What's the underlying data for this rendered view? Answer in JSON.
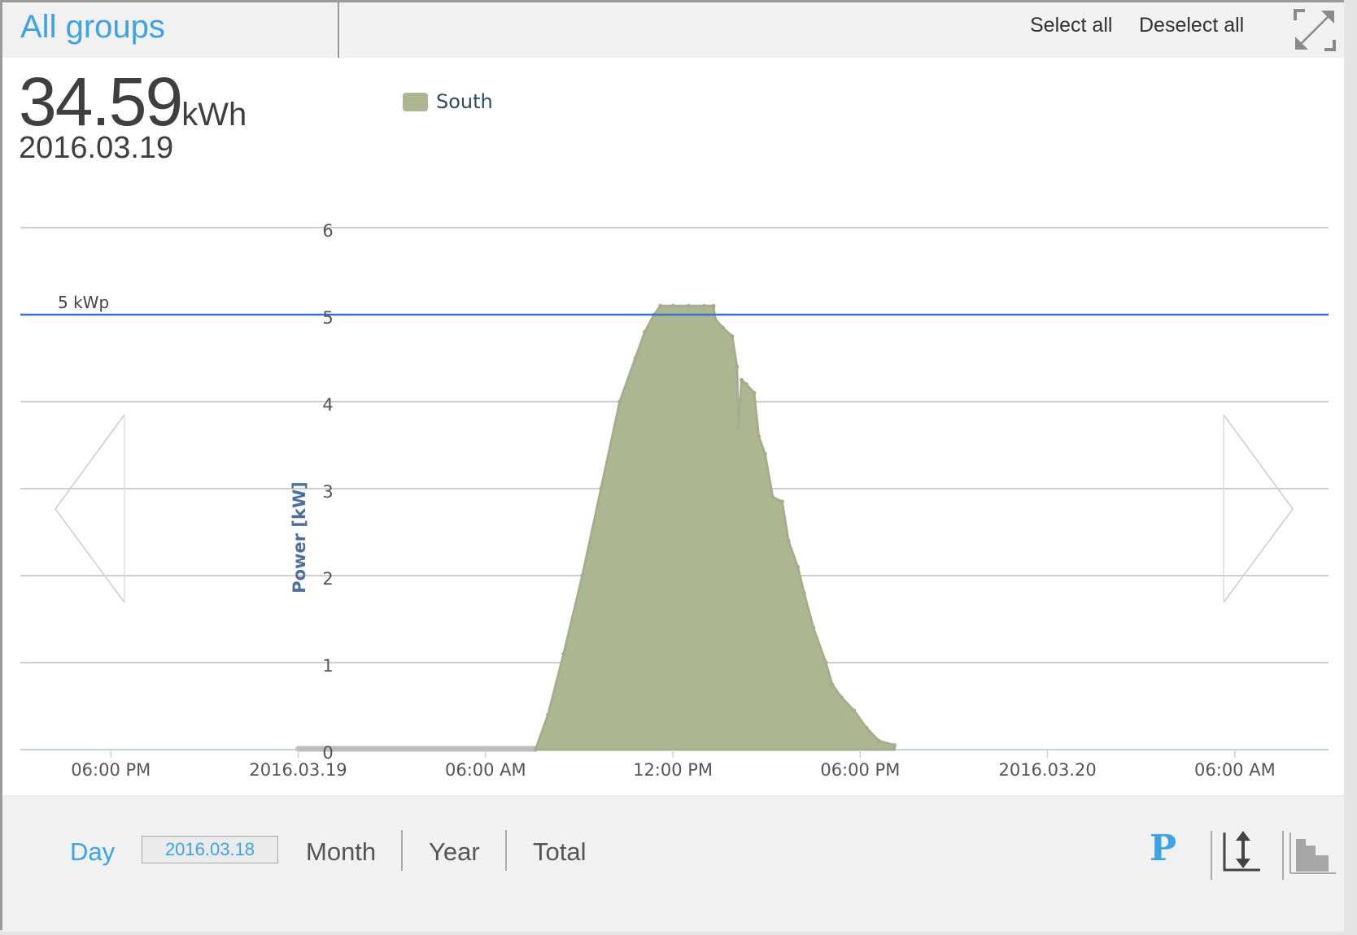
{
  "header": {
    "group_title": "All groups",
    "select_all": "Select all",
    "deselect_all": "Deselect all",
    "expand_icon": "expand-arrows-icon"
  },
  "summary": {
    "value": "34.59",
    "unit": "kWh",
    "date": "2016.03.19"
  },
  "legend": [
    {
      "label": "South",
      "color": "#acb792"
    }
  ],
  "navigation": {
    "prev_icon": "chevron-left-icon",
    "next_icon": "chevron-right-icon"
  },
  "footer": {
    "periods": {
      "day": "Day",
      "month": "Month",
      "year": "Year",
      "total": "Total"
    },
    "active_period": "Day",
    "date_picker_value": "2016.03.18",
    "icons": {
      "power": "P",
      "scale": "y-axis-scale-icon",
      "bars": "bar-chart-icon"
    }
  },
  "colors": {
    "accent": "#3ea3e6",
    "series": "#acb792",
    "reference_line": "#3b73c8",
    "axis_title": "#4d6f99"
  },
  "chart_data": {
    "type": "area",
    "title": "",
    "xlabel": "",
    "ylabel": "Power [kW]",
    "ylim": [
      0,
      6
    ],
    "yticks": [
      0,
      1,
      2,
      3,
      4,
      5,
      6
    ],
    "xlim_hours": [
      -8.9,
      33.0
    ],
    "xticks": [
      {
        "hour": -6,
        "label": "06:00 PM"
      },
      {
        "hour": 0,
        "label": "2016.03.19"
      },
      {
        "hour": 6,
        "label": "06:00 AM"
      },
      {
        "hour": 12,
        "label": "12:00 PM"
      },
      {
        "hour": 18,
        "label": "06:00 PM"
      },
      {
        "hour": 24,
        "label": "2016.03.20"
      },
      {
        "hour": 30,
        "label": "06:00 AM"
      }
    ],
    "grid": true,
    "legend_position": "top-left",
    "reference_line": {
      "value": 5,
      "label": "5 kWp"
    },
    "navigator_range_hours": [
      0,
      7.6
    ],
    "series": [
      {
        "name": "South",
        "x_hours": [
          7.6,
          8.0,
          8.5,
          9.1,
          9.7,
          10.3,
          10.8,
          11.1,
          11.4,
          11.6,
          12.0,
          12.5,
          13.0,
          13.3,
          13.35,
          13.6,
          13.9,
          14.05,
          14.1,
          14.2,
          14.35,
          14.6,
          14.75,
          14.95,
          15.2,
          15.5,
          15.7,
          16.0,
          16.2,
          16.5,
          16.9,
          17.1,
          17.4,
          17.8,
          18.2,
          18.6,
          19.1
        ],
        "values": [
          0.0,
          0.4,
          1.1,
          2.0,
          3.0,
          4.0,
          4.5,
          4.8,
          5.0,
          5.1,
          5.1,
          5.1,
          5.1,
          5.1,
          4.95,
          4.85,
          4.75,
          4.4,
          3.7,
          4.25,
          4.2,
          4.1,
          3.6,
          3.4,
          2.9,
          2.85,
          2.4,
          2.1,
          1.8,
          1.4,
          1.0,
          0.75,
          0.6,
          0.45,
          0.25,
          0.1,
          0.05
        ]
      }
    ]
  }
}
